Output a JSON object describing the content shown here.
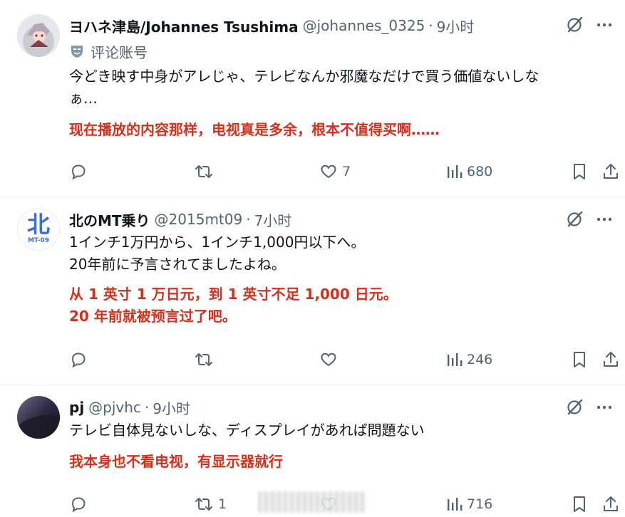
{
  "tweets": [
    {
      "name": "ヨハネ津島/Johannes Tsushima",
      "handle": "@johannes_0325",
      "time": "9小时",
      "badge": "评论账号",
      "text_lines": [
        "今どき映す中身がアレじゃ、テレビなんか邪魔なだけで買う価値ないしな",
        "ぁ…"
      ],
      "translation_lines": [
        "现在播放的内容那样，电视真是多余，根本不值得买啊……"
      ],
      "likes": "7",
      "retweets": "",
      "views": "680"
    },
    {
      "name": "北のMT乗り",
      "handle": "@2015mt09",
      "time": "7小时",
      "avatar_text": "北",
      "avatar_sub": "MT-09",
      "text_lines": [
        "1インチ1万円から、1インチ1,000円以下へ。",
        "20年前に予言されてましたよね。"
      ],
      "translation_lines": [
        "从 1 英寸 1 万日元，到 1 英寸不足 1,000 日元。",
        "20 年前就被预言过了吧。"
      ],
      "likes": "",
      "retweets": "",
      "views": "246"
    },
    {
      "name": "pj",
      "handle": "@pjvhc",
      "time": "9小时",
      "text_lines": [
        "テレビ自体見ないしな、ディスプレイがあれば問題ない"
      ],
      "translation_lines": [
        "我本身也不看电视，有显示器就行"
      ],
      "likes": "",
      "retweets": "1",
      "views": "716"
    }
  ],
  "separator": "·",
  "icons": {
    "reply": "reply-icon",
    "retweet": "retweet-icon",
    "like": "heart-icon",
    "views": "views-icon",
    "bookmark": "bookmark-icon",
    "share": "share-icon",
    "grok": "grok-icon",
    "more": "more-icon",
    "badge": "mask-icon"
  },
  "colors": {
    "translation": "#d4301c",
    "secondary_text": "#536471",
    "primary_text": "#0f1419",
    "divider": "#eff3f4"
  }
}
